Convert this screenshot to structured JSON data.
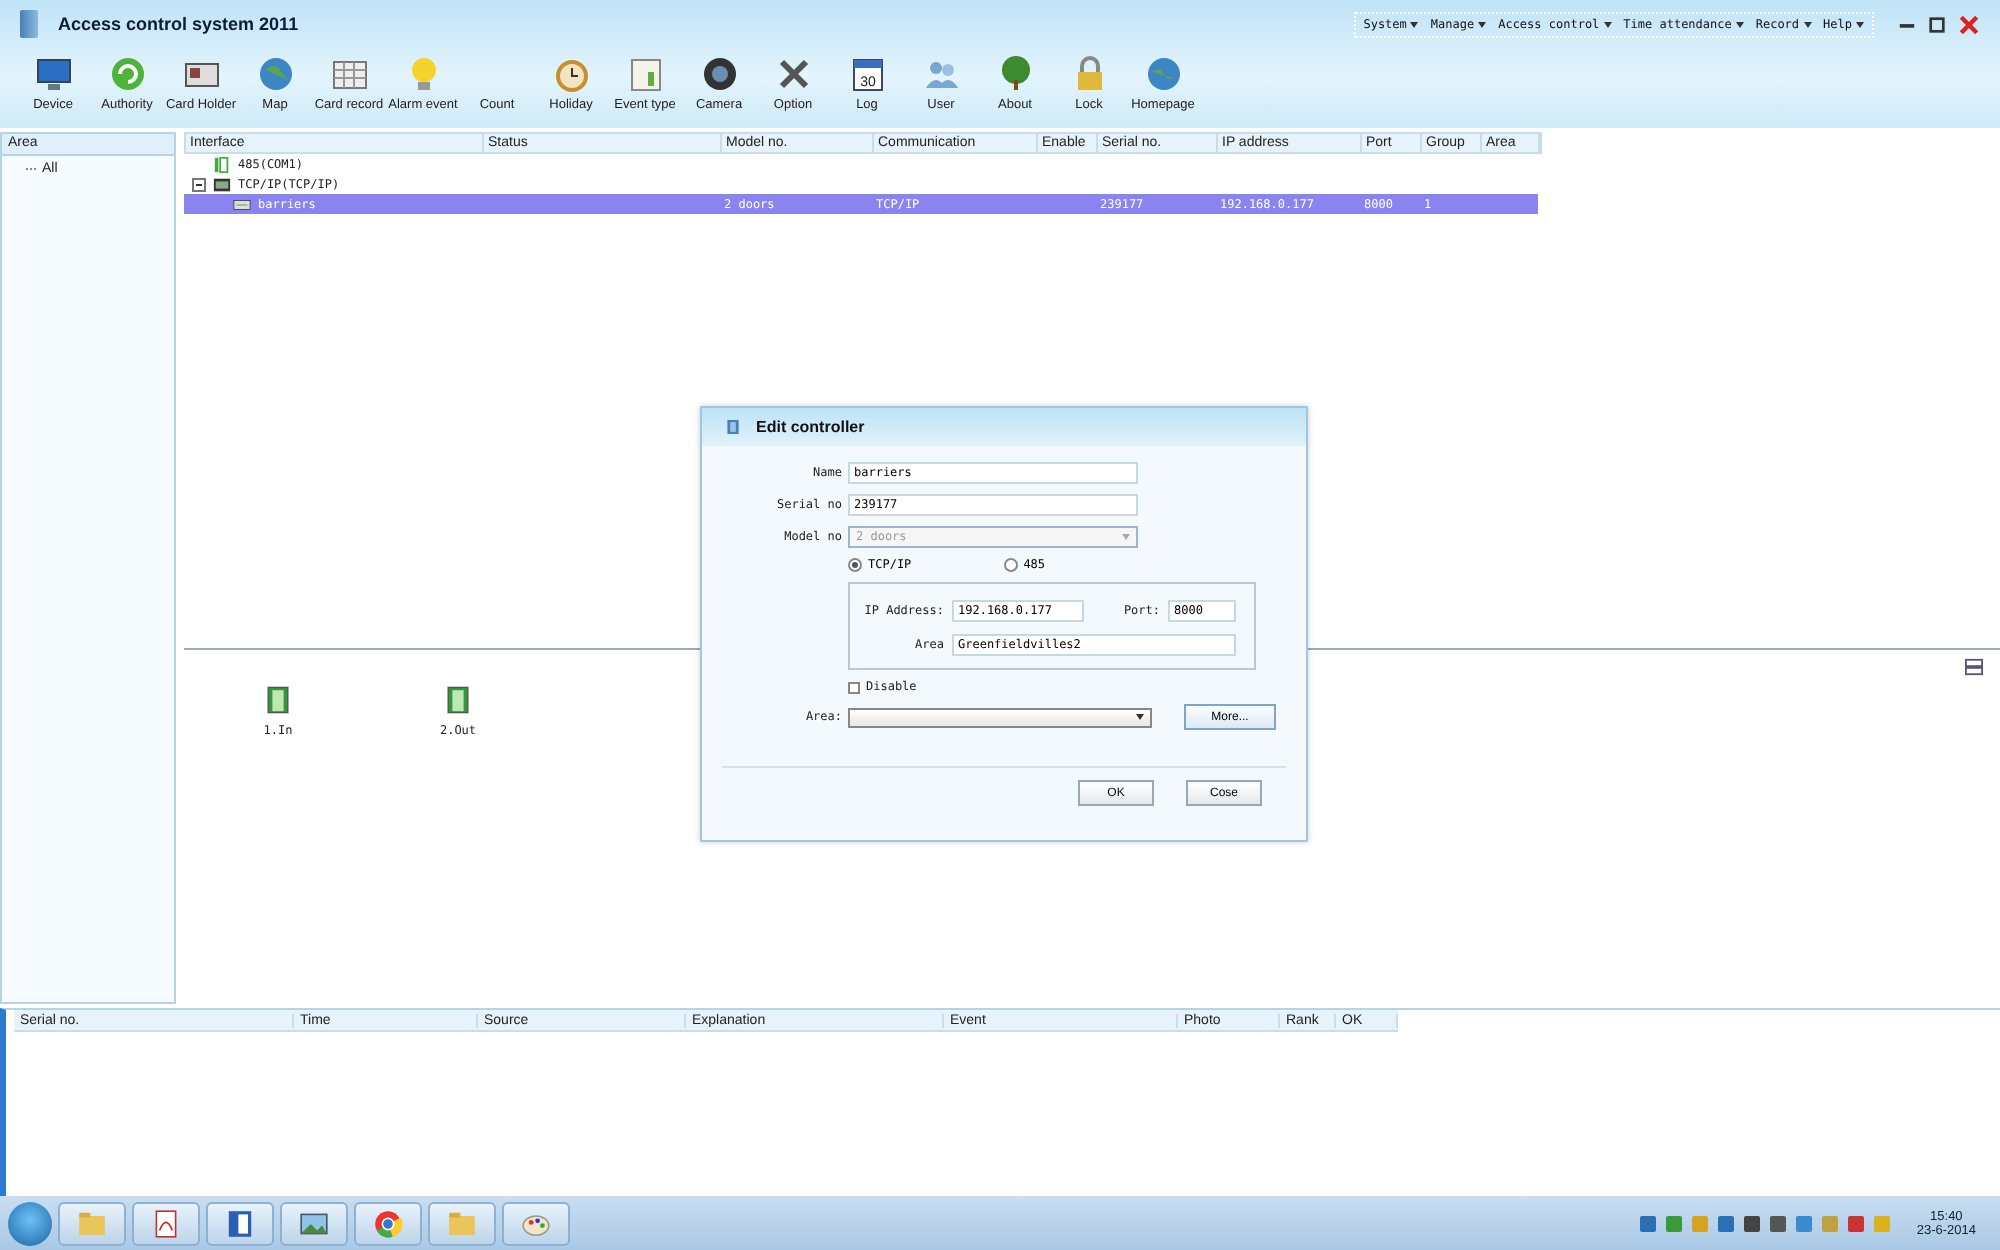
{
  "window": {
    "title": "Access control system 2011"
  },
  "menu": [
    {
      "label": "System"
    },
    {
      "label": "Manage"
    },
    {
      "label": "Access control"
    },
    {
      "label": "Time attendance"
    },
    {
      "label": "Record"
    },
    {
      "label": "Help"
    }
  ],
  "toolbar": [
    {
      "label": "Device"
    },
    {
      "label": "Authority"
    },
    {
      "label": "Card Holder"
    },
    {
      "label": "Map"
    },
    {
      "label": "Card record"
    },
    {
      "label": "Alarm event"
    },
    {
      "label": "Count"
    },
    {
      "label": "Holiday"
    },
    {
      "label": "Event type"
    },
    {
      "label": "Camera"
    },
    {
      "label": "Option"
    },
    {
      "label": "Log"
    },
    {
      "label": "User"
    },
    {
      "label": "About"
    },
    {
      "label": "Lock"
    },
    {
      "label": "Homepage"
    }
  ],
  "log_icon_day": "30",
  "area_panel": {
    "header": "Area",
    "items": [
      {
        "label": "All",
        "selected": false
      }
    ]
  },
  "device_table": {
    "columns": [
      "Interface",
      "Status",
      "Model no.",
      "Communication",
      "Enable",
      "Serial no.",
      "IP address",
      "Port",
      "Group",
      "Area"
    ],
    "tree": [
      {
        "label": "485(COM1)",
        "kind": "port",
        "selected": false
      },
      {
        "label": "TCP/IP(TCP/IP)",
        "kind": "network",
        "expanded": true,
        "selected": false,
        "children": [
          {
            "label": "barriers",
            "kind": "controller",
            "selected": true,
            "cells": {
              "2": "2 doors",
              "3": "TCP/IP",
              "5": "239177",
              "6": "192.168.0.177",
              "7": "8000",
              "8": "1"
            }
          }
        ]
      }
    ]
  },
  "doors": [
    {
      "label": "1.In"
    },
    {
      "label": "2.Out"
    }
  ],
  "event_table": {
    "columns": [
      "Serial no.",
      "Time",
      "Source",
      "Explanation",
      "Event",
      "Photo",
      "Rank",
      "OK"
    ]
  },
  "dialog": {
    "title": "Edit controller",
    "name": {
      "label": "Name",
      "value": "barriers"
    },
    "serial": {
      "label": "Serial no",
      "value": "239177"
    },
    "model": {
      "label": "Model no",
      "value": "2 doors",
      "disabled": true
    },
    "connection": [
      {
        "label": "TCP/IP",
        "selected": true
      },
      {
        "label": "485",
        "selected": false
      }
    ],
    "ip": {
      "label": "IP Address:",
      "value": "192.168.0.177"
    },
    "port": {
      "label": "Port:",
      "value": "8000"
    },
    "area_text": {
      "label": "Area",
      "value": "Greenfieldvilles2"
    },
    "disable": {
      "label": "Disable",
      "checked": false
    },
    "area_select": {
      "label": "Area:"
    },
    "more_button": "More...",
    "buttons": [
      "OK",
      "Cose"
    ]
  },
  "taskbar": {
    "apps": [
      {
        "kind": "folder"
      },
      {
        "kind": "pdf"
      },
      {
        "kind": "word"
      },
      {
        "kind": "picture"
      },
      {
        "kind": "browser"
      },
      {
        "kind": "folder"
      },
      {
        "kind": "paint"
      }
    ],
    "clock": {
      "time": "15:40",
      "date": "23-6-2014"
    }
  }
}
